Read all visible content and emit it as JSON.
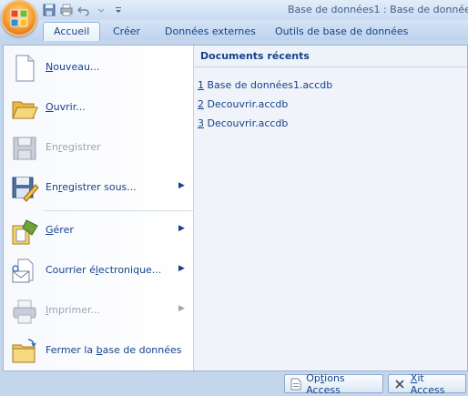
{
  "window": {
    "title": "Base de données1 : Base de données ("
  },
  "quick_access": [
    {
      "name": "save-icon"
    },
    {
      "name": "print-icon"
    },
    {
      "name": "undo-icon"
    },
    {
      "name": "redo-icon"
    },
    {
      "name": "customize-dropdown-icon"
    }
  ],
  "tabs": [
    {
      "label": "Accueil",
      "active": true
    },
    {
      "label": "Créer",
      "active": false
    },
    {
      "label": "Données externes",
      "active": false
    },
    {
      "label": "Outils de base de données",
      "active": false
    }
  ],
  "menu": {
    "items": [
      {
        "label_pre": "",
        "label_u": "N",
        "label_post": "ouveau...",
        "icon": "new-document-icon",
        "enabled": true,
        "submenu": false
      },
      {
        "label_pre": "",
        "label_u": "O",
        "label_post": "uvrir...",
        "icon": "open-folder-icon",
        "enabled": true,
        "submenu": false
      },
      {
        "label_pre": "En",
        "label_u": "r",
        "label_post": "egistrer",
        "icon": "save-disk-icon",
        "enabled": false,
        "submenu": false
      },
      {
        "label_pre": "En",
        "label_u": "r",
        "label_post": "egistrer sous...",
        "icon": "save-as-icon",
        "enabled": true,
        "submenu": true
      },
      {
        "label_pre": "",
        "label_u": "G",
        "label_post": "érer",
        "icon": "manage-icon",
        "enabled": true,
        "submenu": true
      },
      {
        "label_pre": "Courrier é",
        "label_u": "l",
        "label_post": "ectronique...",
        "icon": "email-icon",
        "enabled": true,
        "submenu": true
      },
      {
        "label_pre": "",
        "label_u": "I",
        "label_post": "mprimer...",
        "icon": "printer-icon",
        "enabled": false,
        "submenu": true
      },
      {
        "label_pre": "Fermer la ",
        "label_u": "b",
        "label_post": "ase de données",
        "icon": "close-database-icon",
        "enabled": true,
        "submenu": false
      }
    ]
  },
  "recent": {
    "header": "Documents récents",
    "items": [
      {
        "num": "1",
        "name": " Base de données1.accdb"
      },
      {
        "num": "2",
        "name": " Decouvrir.accdb"
      },
      {
        "num": "3",
        "name": " Decouvrir.accdb"
      }
    ]
  },
  "bottom": {
    "options_pre": "Op",
    "options_u": "t",
    "options_post": "ions Access",
    "exit_pre": "",
    "exit_u": "X",
    "exit_post": "it Access"
  }
}
